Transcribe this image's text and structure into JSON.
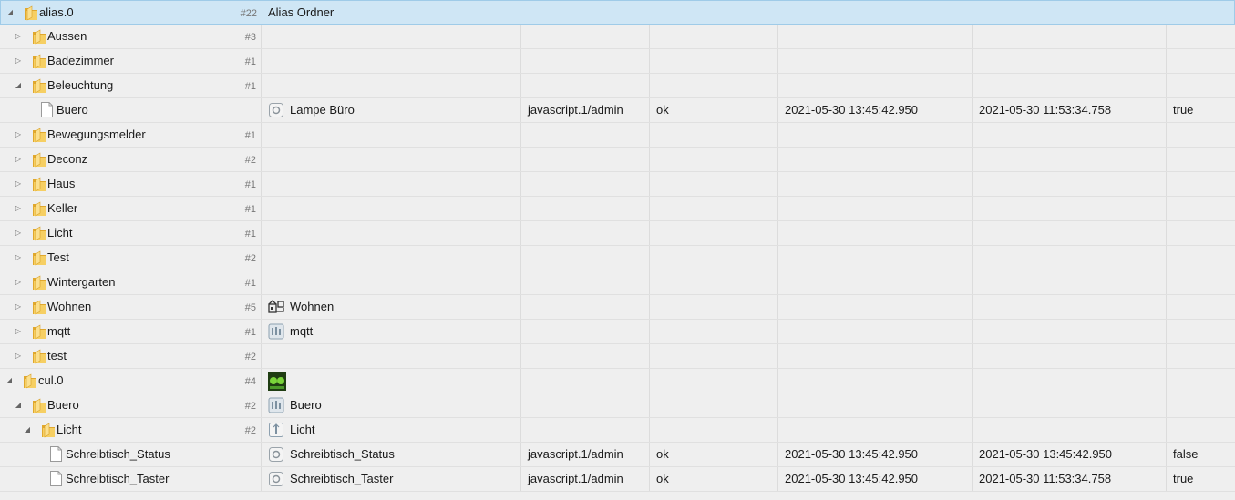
{
  "rows": [
    {
      "name": "alias.0",
      "count": "#22",
      "label": "Alias Ordner",
      "icon": "none",
      "role": "",
      "status": "",
      "ts": "",
      "lc": "",
      "value": ""
    },
    {
      "name": "Aussen",
      "count": "#3",
      "label": "",
      "icon": "none",
      "role": "",
      "status": "",
      "ts": "",
      "lc": "",
      "value": ""
    },
    {
      "name": "Badezimmer",
      "count": "#1",
      "label": "",
      "icon": "none",
      "role": "",
      "status": "",
      "ts": "",
      "lc": "",
      "value": ""
    },
    {
      "name": "Beleuchtung",
      "count": "#1",
      "label": "",
      "icon": "none",
      "role": "",
      "status": "",
      "ts": "",
      "lc": "",
      "value": ""
    },
    {
      "name": "Buero",
      "count": "",
      "label": "Lampe Büro",
      "icon": "state-icon",
      "role": "javascript.1/admin",
      "status": "ok",
      "ts": "2021-05-30 13:45:42.950",
      "lc": "2021-05-30 11:53:34.758",
      "value": "true"
    },
    {
      "name": "Bewegungsmelder",
      "count": "#1",
      "label": "",
      "icon": "none",
      "role": "",
      "status": "",
      "ts": "",
      "lc": "",
      "value": ""
    },
    {
      "name": "Deconz",
      "count": "#2",
      "label": "",
      "icon": "none",
      "role": "",
      "status": "",
      "ts": "",
      "lc": "",
      "value": ""
    },
    {
      "name": "Haus",
      "count": "#1",
      "label": "",
      "icon": "none",
      "role": "",
      "status": "",
      "ts": "",
      "lc": "",
      "value": ""
    },
    {
      "name": "Keller",
      "count": "#1",
      "label": "",
      "icon": "none",
      "role": "",
      "status": "",
      "ts": "",
      "lc": "",
      "value": ""
    },
    {
      "name": "Licht",
      "count": "#1",
      "label": "",
      "icon": "none",
      "role": "",
      "status": "",
      "ts": "",
      "lc": "",
      "value": ""
    },
    {
      "name": "Test",
      "count": "#2",
      "label": "",
      "icon": "none",
      "role": "",
      "status": "",
      "ts": "",
      "lc": "",
      "value": ""
    },
    {
      "name": "Wintergarten",
      "count": "#1",
      "label": "",
      "icon": "none",
      "role": "",
      "status": "",
      "ts": "",
      "lc": "",
      "value": ""
    },
    {
      "name": "Wohnen",
      "count": "#5",
      "label": "Wohnen",
      "icon": "house-icon",
      "role": "",
      "status": "",
      "ts": "",
      "lc": "",
      "value": ""
    },
    {
      "name": "mqtt",
      "count": "#1",
      "label": "mqtt",
      "icon": "channel-icon",
      "role": "",
      "status": "",
      "ts": "",
      "lc": "",
      "value": ""
    },
    {
      "name": "test",
      "count": "#2",
      "label": "",
      "icon": "none",
      "role": "",
      "status": "",
      "ts": "",
      "lc": "",
      "value": ""
    },
    {
      "name": "cul.0",
      "count": "#4",
      "label": "",
      "icon": "cul-adapter-icon",
      "role": "",
      "status": "",
      "ts": "",
      "lc": "",
      "value": ""
    },
    {
      "name": "Buero",
      "count": "#2",
      "label": "Buero",
      "icon": "channel-icon",
      "role": "",
      "status": "",
      "ts": "",
      "lc": "",
      "value": ""
    },
    {
      "name": "Licht",
      "count": "#2",
      "label": "Licht",
      "icon": "switch-icon",
      "role": "",
      "status": "",
      "ts": "",
      "lc": "",
      "value": ""
    },
    {
      "name": "Schreibtisch_Status",
      "count": "",
      "label": "Schreibtisch_Status",
      "icon": "state-icon",
      "role": "javascript.1/admin",
      "status": "ok",
      "ts": "2021-05-30 13:45:42.950",
      "lc": "2021-05-30 13:45:42.950",
      "value": "false"
    },
    {
      "name": "Schreibtisch_Taster",
      "count": "",
      "label": "Schreibtisch_Taster",
      "icon": "state-icon",
      "role": "javascript.1/admin",
      "status": "ok",
      "ts": "2021-05-30 13:45:42.950",
      "lc": "2021-05-30 11:53:34.758",
      "value": "true"
    }
  ],
  "colors": {
    "selected_row": "#cfe6f5",
    "folder": "#f2c14e",
    "background": "#efefef"
  }
}
